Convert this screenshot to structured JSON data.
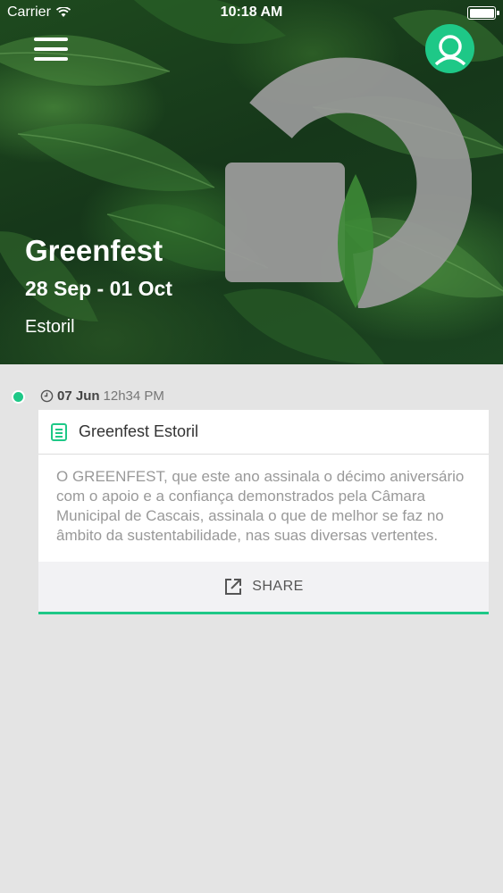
{
  "status_bar": {
    "carrier": "Carrier",
    "time": "10:18 AM"
  },
  "header": {
    "menu_icon": "hamburger-menu-icon",
    "profile_icon": "user-profile-icon"
  },
  "event": {
    "title": "Greenfest",
    "dates": "28 Sep - 01 Oct",
    "location": "Estoril"
  },
  "feed": {
    "items": [
      {
        "date": "07 Jun",
        "time": "12h34 PM",
        "title": "Greenfest Estoril",
        "excerpt": "O GREENFEST, que este ano assinala o décimo aniversário com o apoio e a confiança demonstrados pela Câmara Municipal de Cascais, assinala o que de melhor se faz no âmbito da sustentabilidade, nas suas diversas vertentes.",
        "share_label": "SHARE"
      }
    ]
  },
  "colors": {
    "accent": "#1ec887",
    "background": "#e4e4e4"
  }
}
